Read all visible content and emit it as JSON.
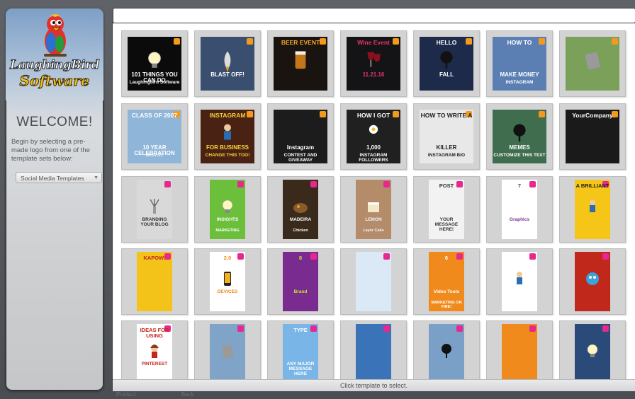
{
  "sidebar": {
    "brand_line1": "LaughingBird",
    "brand_line2": "Software",
    "welcome": "WELCOME!",
    "instructions": "Begin by selecting a pre-made logo from one of the template sets below:",
    "template_set_selected": "Social Media Templates"
  },
  "status": {
    "hint": "Click template to select.",
    "ghost_left": "Product",
    "ghost_right": "Back"
  },
  "colors": {
    "sidebar_top": "#8aa7c9",
    "panel_bg": "#ffffff",
    "tile_bg": "#d3d3d3",
    "accent_pink": "#e8288f",
    "accent_orange": "#f39a1e"
  },
  "templates": [
    {
      "top": "",
      "main": "101 THINGS YOU CAN DO",
      "sub": "Laughingbird Software",
      "bg": "#0b0b0b",
      "fg": "#ffffff",
      "shape": "square",
      "icon": "lightbulb"
    },
    {
      "top": "",
      "main": "BLAST OFF!",
      "sub": "",
      "bg": "#3a4f6f",
      "fg": "#ffffff",
      "shape": "square",
      "icon": "rocket"
    },
    {
      "top": "BEER EVENT",
      "main": "",
      "sub": "",
      "bg": "#1a1410",
      "fg": "#f5a623",
      "shape": "square",
      "icon": "beer"
    },
    {
      "top": "Wine Event",
      "main": "11.21.16",
      "sub": "",
      "bg": "#141416",
      "fg": "#e3346a",
      "shape": "square",
      "icon": "wine"
    },
    {
      "top": "HELLO",
      "main": "FALL",
      "sub": "",
      "bg": "#1d2a4a",
      "fg": "#ffffff",
      "shape": "square",
      "icon": "tree"
    },
    {
      "top": "HOW TO",
      "main": "MAKE MONEY",
      "sub": "INSTAGRAM",
      "bg": "#5b7fb3",
      "fg": "#ffffff",
      "shape": "square",
      "icon": "none"
    },
    {
      "top": "",
      "main": "",
      "sub": "",
      "bg": "#7aa05a",
      "fg": "#ffffff",
      "shape": "square",
      "icon": "note"
    },
    {
      "top": "CLASS OF 2007",
      "main": "10 YEAR CELEBRATION",
      "sub": "06.07.17",
      "bg": "#8fb6d9",
      "fg": "#ffffff",
      "shape": "square",
      "icon": "none"
    },
    {
      "top": "INSTAGRAM",
      "main": "FOR BUSINESS",
      "sub": "CHANGE THIS TOO!",
      "bg": "#4a2214",
      "fg": "#f7d23a",
      "shape": "square",
      "icon": "man"
    },
    {
      "top": "",
      "main": "Instagram",
      "sub": "CONTEST AND GIVEAWAY",
      "bg": "#1c1c1c",
      "fg": "#ffffff",
      "shape": "square",
      "icon": "none"
    },
    {
      "top": "HOW I GOT",
      "main": "1,000",
      "sub": "INSTAGRAM FOLLOWERS",
      "bg": "#202020",
      "fg": "#ffffff",
      "shape": "square",
      "icon": "flower"
    },
    {
      "top": "HOW TO WRITE A",
      "main": "KILLER",
      "sub": "INSTAGRAM BIO",
      "bg": "#e8e8e8",
      "fg": "#222222",
      "shape": "square",
      "icon": "none"
    },
    {
      "top": "",
      "main": "MEMES",
      "sub": "CUSTOMIZE THIS TEXT",
      "bg": "#3f6d4e",
      "fg": "#ffffff",
      "shape": "square",
      "icon": "tree"
    },
    {
      "top": "YourCompany",
      "main": "",
      "sub": "",
      "bg": "#1a1a1a",
      "fg": "#ffffff",
      "shape": "square",
      "icon": "none"
    },
    {
      "top": "",
      "main": "BRANDING YOUR BLOG",
      "sub": "",
      "bg": "#d9d9d9",
      "fg": "#333333",
      "shape": "tall",
      "icon": "plant"
    },
    {
      "top": "",
      "main": "INSIGHTS",
      "sub": "MARKETING",
      "bg": "#6bbf3a",
      "fg": "#ffffff",
      "shape": "tall",
      "icon": "lightbulb"
    },
    {
      "top": "",
      "main": "MADEIRA",
      "sub": "Chicken",
      "bg": "#3a2a1c",
      "fg": "#ffffff",
      "shape": "tall",
      "icon": "food"
    },
    {
      "top": "",
      "main": "LEMON",
      "sub": "Layer Cake",
      "bg": "#b48c6a",
      "fg": "#e8f4ff",
      "shape": "tall",
      "icon": "cake"
    },
    {
      "top": "POST",
      "main": "YOUR MESSAGE HERE!",
      "sub": "",
      "bg": "#f2f2f2",
      "fg": "#333333",
      "shape": "tall",
      "icon": "none"
    },
    {
      "top": "7",
      "main": "Graphics",
      "sub": "",
      "bg": "#ffffff",
      "fg": "#7a2b8f",
      "shape": "tall",
      "icon": "none"
    },
    {
      "top": "A BRILLIANT",
      "main": "",
      "sub": "",
      "bg": "#f5c518",
      "fg": "#1f1f1f",
      "shape": "tall",
      "icon": "man"
    },
    {
      "top": "KAPOW!",
      "main": "",
      "sub": "",
      "bg": "#f3c31a",
      "fg": "#c0281c",
      "shape": "tall",
      "icon": "none"
    },
    {
      "top": "2.0",
      "main": "DEVICES",
      "sub": "",
      "bg": "#ffffff",
      "fg": "#f08a1c",
      "shape": "tall",
      "icon": "phone"
    },
    {
      "top": "8",
      "main": "Brand",
      "sub": "",
      "bg": "#7a2b8f",
      "fg": "#c8e034",
      "shape": "tall",
      "icon": "none"
    },
    {
      "top": "",
      "main": "",
      "sub": "",
      "bg": "#dbe8f5",
      "fg": "#2a4a7a",
      "shape": "tall",
      "icon": "none"
    },
    {
      "top": "6",
      "main": "Video Tools",
      "sub": "MARKETING ON FIRE!",
      "bg": "#f08a1c",
      "fg": "#ffffff",
      "shape": "tall",
      "icon": "none"
    },
    {
      "top": "",
      "main": "",
      "sub": "",
      "bg": "#ffffff",
      "fg": "#2a6db0",
      "shape": "tall",
      "icon": "man"
    },
    {
      "top": "",
      "main": "",
      "sub": "",
      "bg": "#c0281c",
      "fg": "#ffffff",
      "shape": "tall",
      "icon": "blob"
    },
    {
      "top": "IDEAS FOR USING",
      "main": "PINTEREST",
      "sub": "",
      "bg": "#ffffff",
      "fg": "#c0281c",
      "shape": "tall",
      "icon": "girl"
    },
    {
      "top": "",
      "main": "",
      "sub": "",
      "bg": "#7fa4c8",
      "fg": "#ffffff",
      "shape": "tall",
      "icon": "note"
    },
    {
      "top": "TYPE",
      "main": "ANY MAJOR MESSAGE HERE",
      "sub": "",
      "bg": "#79b5e6",
      "fg": "#ffffff",
      "shape": "tall",
      "icon": "none"
    },
    {
      "top": "",
      "main": "",
      "sub": "",
      "bg": "#3a73b8",
      "fg": "#ffffff",
      "shape": "tall",
      "icon": "none"
    },
    {
      "top": "",
      "main": "",
      "sub": "",
      "bg": "#7aa0c8",
      "fg": "#ffffff",
      "shape": "tall",
      "icon": "tree"
    },
    {
      "top": "",
      "main": "",
      "sub": "",
      "bg": "#f08a1c",
      "fg": "#ffffff",
      "shape": "tall",
      "icon": "none"
    },
    {
      "top": "",
      "main": "",
      "sub": "",
      "bg": "#2a4a7a",
      "fg": "#ffffff",
      "shape": "tall",
      "icon": "lightbulb"
    }
  ]
}
